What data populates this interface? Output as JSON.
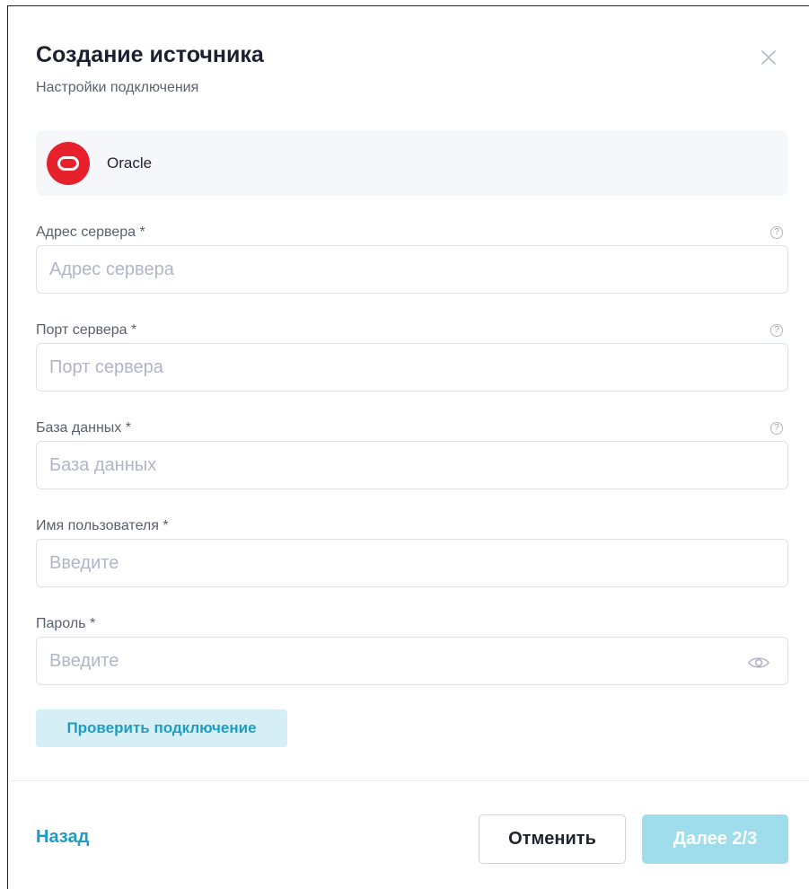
{
  "header": {
    "title": "Создание источника",
    "subtitle": "Настройки подключения"
  },
  "source": {
    "name": "Oracle",
    "logo_color": "#e7212b"
  },
  "fields": [
    {
      "label": "Адрес сервера *",
      "placeholder": "Адрес сервера",
      "value": "",
      "help_icon": "question-circle-icon"
    },
    {
      "label": "Порт сервера *",
      "placeholder": "Порт сервера",
      "value": "",
      "help_icon": "question-circle-icon"
    },
    {
      "label": "База данных *",
      "placeholder": "База данных",
      "value": "",
      "help_icon": "question-circle-icon"
    },
    {
      "label": "Имя пользователя *",
      "placeholder": "Введите",
      "value": ""
    },
    {
      "label": "Пароль *",
      "placeholder": "Введите",
      "value": "",
      "toggle_icon": "eye-icon"
    }
  ],
  "help_glyph": "?",
  "check_button": {
    "label": "Проверить подключение"
  },
  "footer": {
    "back_label": "Назад",
    "cancel_label": "Отменить",
    "next_label": "Далее 2/3"
  },
  "colors": {
    "accent": "#1e9dc3",
    "accent_light": "#d6eff6",
    "next_disabled": "#9fdcec"
  }
}
